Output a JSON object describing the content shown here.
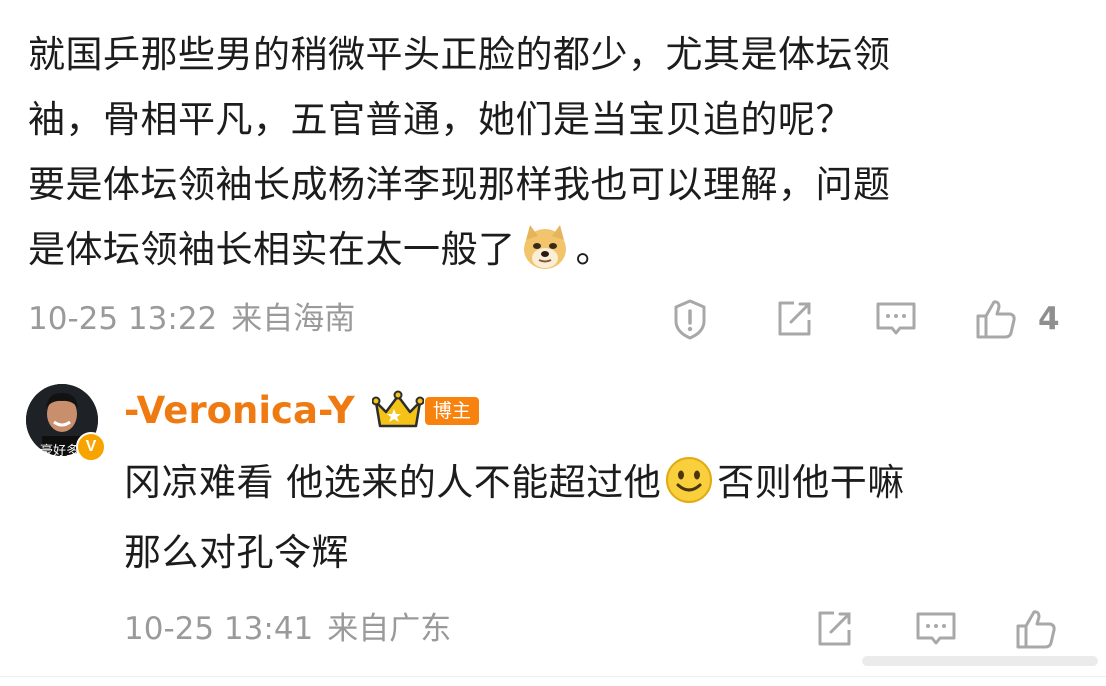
{
  "comment": {
    "lines": [
      "就国乒那些男的稍微平头正脸的都少，尤其是体坛领",
      "袖，骨相平凡，五官普通，她们是当宝贝追的呢？",
      "要是体坛领袖长成杨洋李现那样我也可以理解，问题"
    ],
    "last_line_before": "是体坛领袖长相实在太一般了",
    "last_line_after": "。",
    "emoji": "doge-emoji",
    "date": "10-25 13:22",
    "location": "来自海南",
    "like_count": "4"
  },
  "reply": {
    "username": "-Veronica-Y",
    "badge_label": "博主",
    "avatar_caption": "豪好多",
    "verified_mark": "V",
    "line1_before": "冈凉难看 他选来的人不能超过他",
    "line1_after": "否则他干嘛",
    "line2": "那么对孔令辉",
    "emoji": "smile-emoji",
    "date": "10-25 13:41",
    "location": "来自广东"
  },
  "colors": {
    "text": "#1c1c1c",
    "meta": "#9a9a9a",
    "username": "#ef7a12",
    "badge": "#f7820d",
    "icon": "#a8a8a8"
  }
}
